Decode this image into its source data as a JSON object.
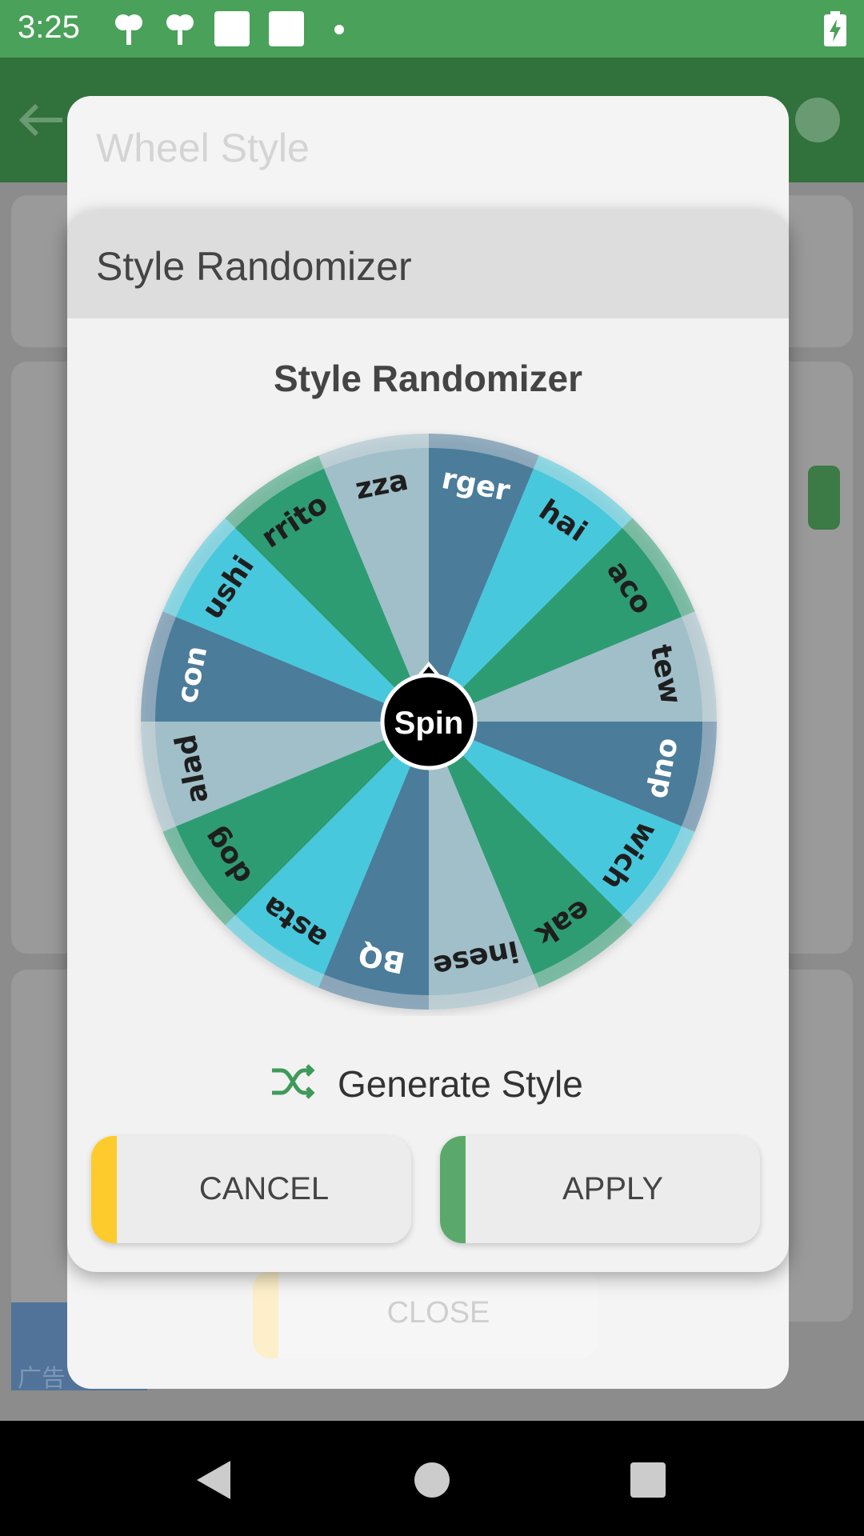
{
  "status_bar": {
    "time": "3:25",
    "icons": [
      "notification-icon",
      "notification-icon",
      "notification-icon",
      "notification-icon",
      "dot-icon",
      "battery-charging-icon"
    ]
  },
  "background": {
    "title": "Wheel Style",
    "close_label": "CLOSE",
    "ad_label": "广告"
  },
  "dialog": {
    "header_title": "Style Randomizer",
    "wheel_title": "Style Randomizer",
    "spin_label": "Spin",
    "wheel_labels": [
      "rger",
      "hai",
      "aco",
      "tew",
      "oup",
      "wich",
      "eak",
      "inese",
      "BQ",
      "asta",
      "dog",
      "alad",
      "con",
      "ushi",
      "rrito",
      "zza"
    ],
    "wheel_colors": [
      "#4b7c9a",
      "#48c8dc",
      "#2e9c72",
      "#a0bfc9"
    ],
    "generate_label": "Generate Style",
    "generate_icon": "shuffle-icon",
    "cancel_label": "CANCEL",
    "apply_label": "APPLY",
    "cancel_color": "#fdcb2c",
    "apply_color": "#5aa96a"
  },
  "nav_bar": {
    "icons": [
      "back-icon",
      "home-icon",
      "recents-icon"
    ]
  }
}
